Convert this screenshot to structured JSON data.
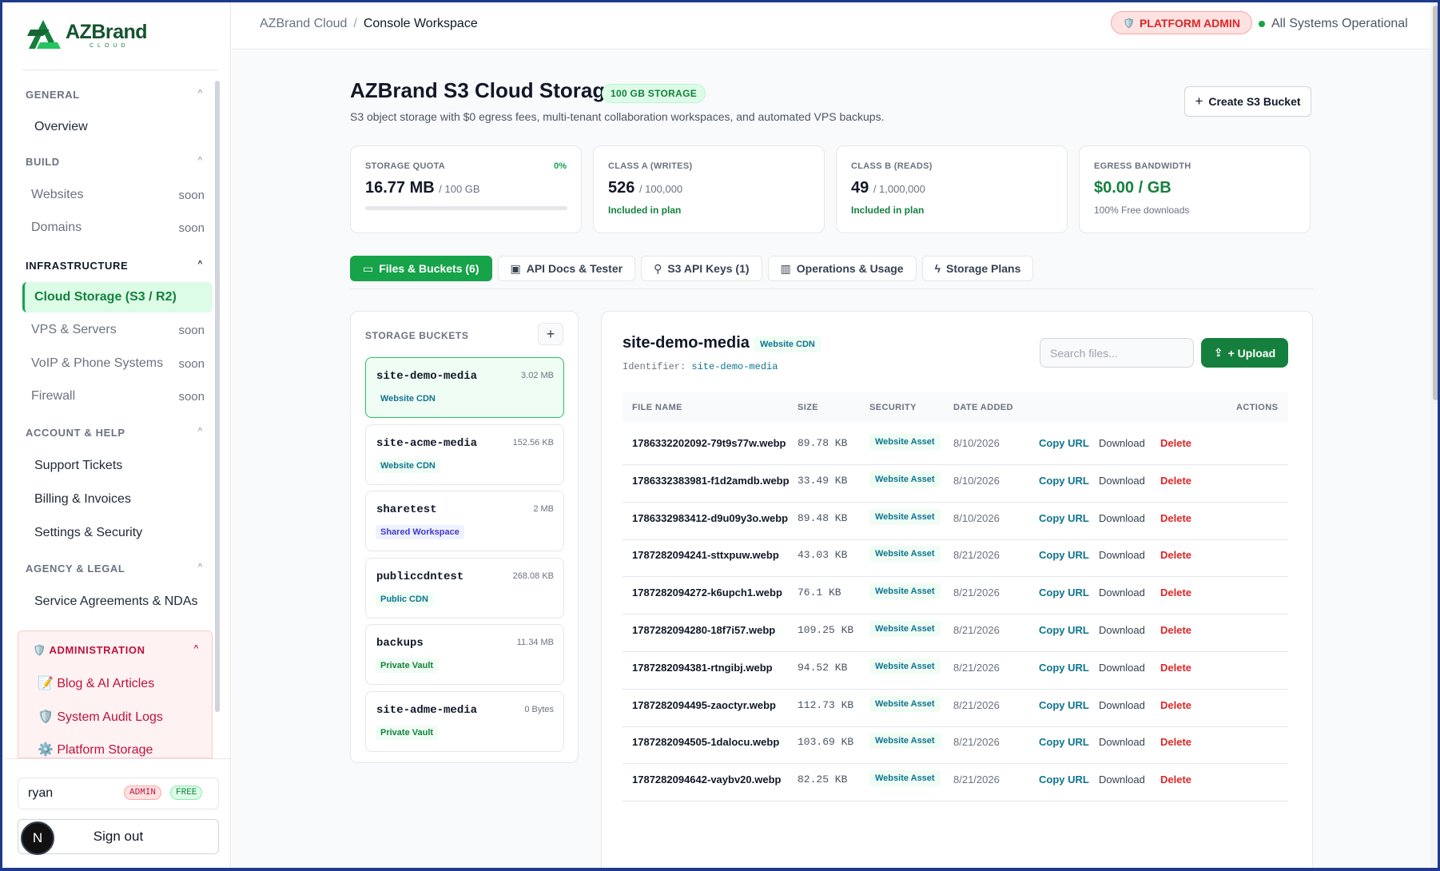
{
  "brand": {
    "name": "AZBrand",
    "sub": "CLOUD"
  },
  "sidebar": {
    "sections": {
      "general": "GENERAL",
      "build": "BUILD",
      "infrastructure": "INFRASTRUCTURE",
      "account": "ACCOUNT & HELP",
      "agency": "AGENCY & LEGAL",
      "administration": "ADMINISTRATION"
    },
    "soon_label": "soon",
    "items": {
      "overview": "Overview",
      "websites": "Websites",
      "domains": "Domains",
      "cloud_storage": "Cloud Storage (S3 / R2)",
      "vps": "VPS & Servers",
      "voip": "VoIP & Phone Systems",
      "firewall": "Firewall",
      "support": "Support Tickets",
      "billing": "Billing & Invoices",
      "settings": "Settings & Security",
      "agreements": "Service Agreements & NDAs",
      "blog": "📝 Blog & AI Articles",
      "audit": "🛡️ System Audit Logs",
      "platform_storage": "⚙️ Platform Storage"
    },
    "user": {
      "name": "ryan",
      "role_badge": "ADMIN",
      "plan_badge": "FREE",
      "avatar_letter": "N"
    },
    "sign_out": "Sign out"
  },
  "topbar": {
    "crumb_root": "AZBrand Cloud",
    "crumb_sep": "/",
    "crumb_current": "Console Workspace",
    "platform_admin": "PLATFORM ADMIN",
    "status": "All Systems Operational"
  },
  "page": {
    "title": "AZBrand S3 Cloud Storage",
    "badge": "100 GB STORAGE",
    "subtitle": "S3 object storage with $0 egress fees, multi-tenant collaboration workspaces, and automated VPS backups.",
    "create_button": "Create S3 Bucket"
  },
  "stats": {
    "quota": {
      "label": "STORAGE QUOTA",
      "pct": "0%",
      "value": "16.77 MB",
      "of": "/ 100 GB",
      "fill": 0
    },
    "class_a": {
      "label": "CLASS A (WRITES)",
      "value": "526",
      "of": "/ 100,000",
      "sub": "Included in plan"
    },
    "class_b": {
      "label": "CLASS B (READS)",
      "value": "49",
      "of": "/ 1,000,000",
      "sub": "Included in plan"
    },
    "egress": {
      "label": "EGRESS BANDWIDTH",
      "value": "$0.00 / GB",
      "sub": "100% Free downloads"
    }
  },
  "tabs": {
    "files": "Files & Buckets (6)",
    "docs": "API Docs & Tester",
    "keys": "S3 API Keys (1)",
    "ops": "Operations & Usage",
    "plans": "Storage Plans"
  },
  "buckets_panel": {
    "header": "STORAGE BUCKETS",
    "add": "+",
    "items": [
      {
        "name": "site-demo-media",
        "size": "3.02 MB",
        "tag": "Website CDN"
      },
      {
        "name": "site-acme-media",
        "size": "152.56 KB",
        "tag": "Website CDN"
      },
      {
        "name": "sharetest",
        "size": "2 MB",
        "tag": "Shared Workspace"
      },
      {
        "name": "publiccdntest",
        "size": "268.08 KB",
        "tag": "Public CDN"
      },
      {
        "name": "backups",
        "size": "11.34 MB",
        "tag": "Private Vault"
      },
      {
        "name": "site-adme-media",
        "size": "0 Bytes",
        "tag": "Private Vault"
      }
    ]
  },
  "files_panel": {
    "title": "site-demo-media",
    "badge": "Website CDN",
    "identifier_label": "Identifier:",
    "identifier_value": "site-demo-media",
    "search_placeholder": "Search files...",
    "upload": "+ Upload",
    "columns": {
      "name": "FILE NAME",
      "size": "SIZE",
      "security": "SECURITY",
      "date": "DATE ADDED",
      "actions": "ACTIONS"
    },
    "actions": {
      "copy": "Copy URL",
      "download": "Download",
      "delete": "Delete"
    },
    "rows": [
      {
        "name": "1786332202092-79t9s77w.webp",
        "size": "89.78 KB",
        "security": "Website Asset",
        "date": "8/10/2026"
      },
      {
        "name": "1786332383981-f1d2amdb.webp",
        "size": "33.49 KB",
        "security": "Website Asset",
        "date": "8/10/2026"
      },
      {
        "name": "1786332983412-d9u09y3o.webp",
        "size": "89.48 KB",
        "security": "Website Asset",
        "date": "8/10/2026"
      },
      {
        "name": "1787282094241-sttxpuw.webp",
        "size": "43.03 KB",
        "security": "Website Asset",
        "date": "8/21/2026"
      },
      {
        "name": "1787282094272-k6upch1.webp",
        "size": "76.1 KB",
        "security": "Website Asset",
        "date": "8/21/2026"
      },
      {
        "name": "1787282094280-18f7i57.webp",
        "size": "109.25 KB",
        "security": "Website Asset",
        "date": "8/21/2026"
      },
      {
        "name": "1787282094381-rtngibj.webp",
        "size": "94.52 KB",
        "security": "Website Asset",
        "date": "8/21/2026"
      },
      {
        "name": "1787282094495-zaoctyr.webp",
        "size": "112.73 KB",
        "security": "Website Asset",
        "date": "8/21/2026"
      },
      {
        "name": "1787282094505-1dalocu.webp",
        "size": "103.69 KB",
        "security": "Website Asset",
        "date": "8/21/2026"
      },
      {
        "name": "1787282094642-vaybv20.webp",
        "size": "82.25 KB",
        "security": "Website Asset",
        "date": "8/21/2026"
      }
    ]
  }
}
